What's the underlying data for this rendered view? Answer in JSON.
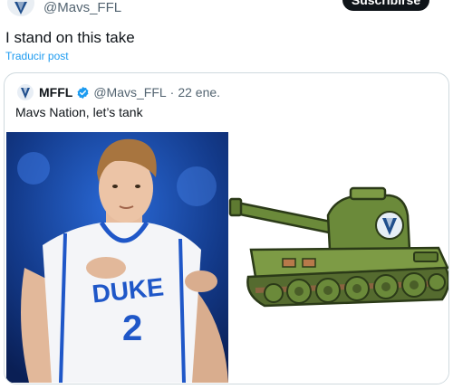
{
  "header": {
    "handle": "@Mavs_FFL",
    "subscribe_label": "Suscribirse"
  },
  "tweet": {
    "text": "I stand on this take",
    "translate_label": "Traducir post"
  },
  "quote": {
    "name": "MFFL",
    "handle": "@Mavs_FFL",
    "separator": "·",
    "date": "22 ene.",
    "text": "Mavs Nation, let’s tank",
    "jersey_text": "DUKE",
    "jersey_number": "2"
  },
  "colors": {
    "link": "#1d9bf0",
    "muted": "#536471",
    "text": "#0f1419",
    "verified": "#1d9bf0",
    "tank_green": "#6b8a3a"
  }
}
